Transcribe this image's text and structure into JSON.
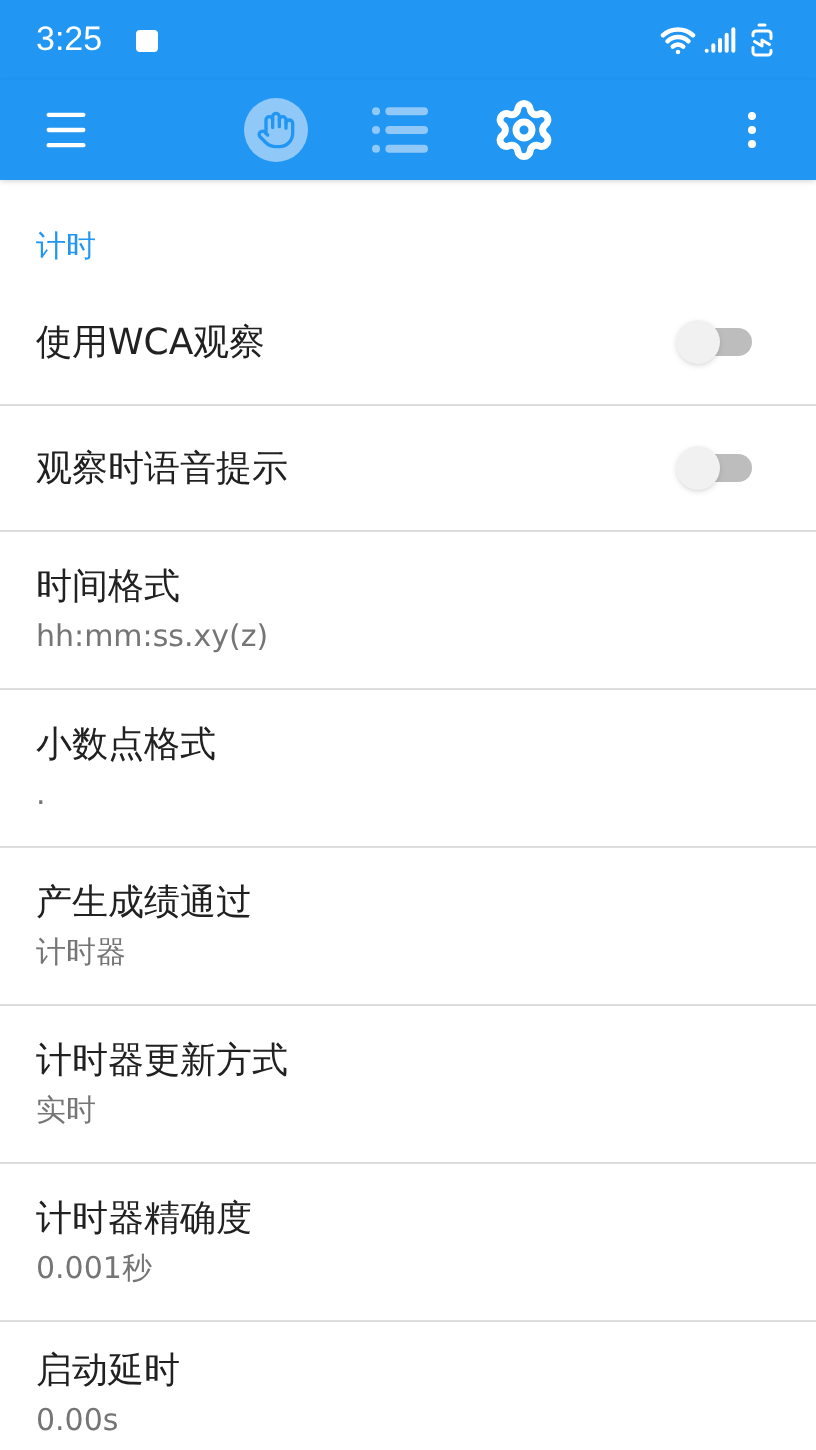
{
  "status_bar": {
    "time": "3:25"
  },
  "toolbar": {
    "tabs": [
      {
        "kind": "hand",
        "selected": false
      },
      {
        "kind": "list",
        "selected": false
      },
      {
        "kind": "settings",
        "selected": true
      }
    ]
  },
  "section": {
    "title": "计时"
  },
  "settings": [
    {
      "kind": "switch",
      "title": "使用WCA观察",
      "on": false
    },
    {
      "kind": "switch",
      "title": "观察时语音提示",
      "on": false
    },
    {
      "kind": "value",
      "title": "时间格式",
      "value": "hh:mm:ss.xy(z)"
    },
    {
      "kind": "value",
      "title": "小数点格式",
      "value": "."
    },
    {
      "kind": "value",
      "title": "产生成绩通过",
      "value": "计时器"
    },
    {
      "kind": "value",
      "title": "计时器更新方式",
      "value": "实时"
    },
    {
      "kind": "value",
      "title": "计时器精确度",
      "value": "0.001秒"
    },
    {
      "kind": "value",
      "title": "启动延时",
      "value": "0.00s"
    }
  ]
}
